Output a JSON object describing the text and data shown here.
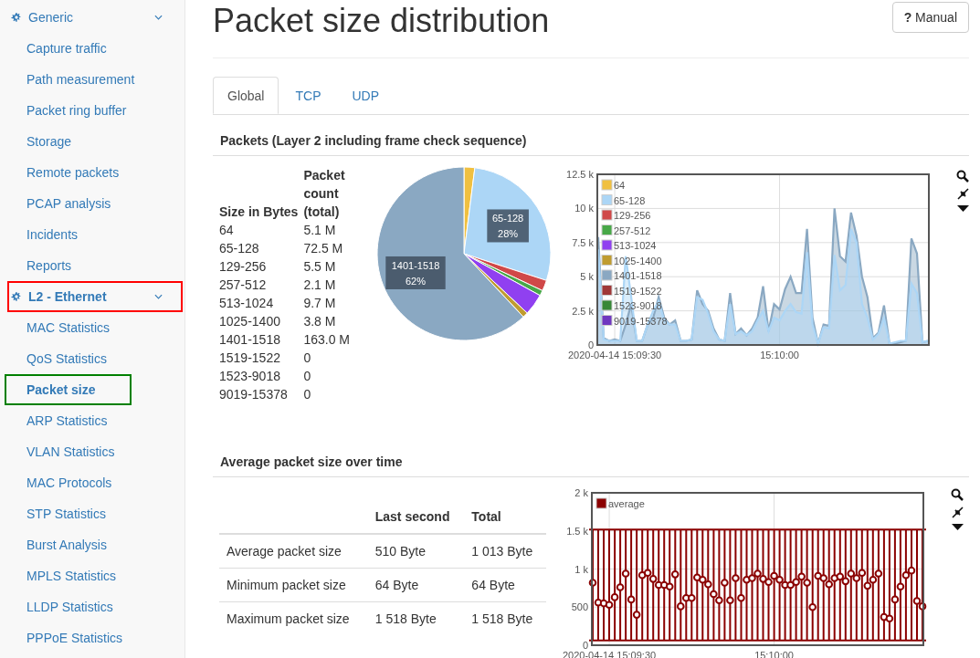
{
  "sidebar": {
    "groups": [
      {
        "label": "Generic",
        "expanded": true,
        "active": false,
        "items": [
          {
            "label": "Capture traffic",
            "selected": false
          },
          {
            "label": "Path measurement",
            "selected": false
          },
          {
            "label": "Packet ring buffer",
            "selected": false
          },
          {
            "label": "Storage",
            "selected": false
          },
          {
            "label": "Remote packets",
            "selected": false
          },
          {
            "label": "PCAP analysis",
            "selected": false
          },
          {
            "label": "Incidents",
            "selected": false
          },
          {
            "label": "Reports",
            "selected": false
          }
        ]
      },
      {
        "label": "L2 - Ethernet",
        "expanded": true,
        "active": true,
        "color": "#ff0000",
        "items": [
          {
            "label": "MAC Statistics",
            "selected": false
          },
          {
            "label": "QoS Statistics",
            "selected": false
          },
          {
            "label": "Packet size",
            "selected": true,
            "color": "#008000"
          },
          {
            "label": "ARP Statistics",
            "selected": false
          },
          {
            "label": "VLAN Statistics",
            "selected": false
          },
          {
            "label": "MAC Protocols",
            "selected": false
          },
          {
            "label": "STP Statistics",
            "selected": false
          },
          {
            "label": "Burst Analysis",
            "selected": false
          },
          {
            "label": "MPLS Statistics",
            "selected": false
          },
          {
            "label": "LLDP Statistics",
            "selected": false
          },
          {
            "label": "PPPoE Statistics",
            "selected": false
          }
        ]
      }
    ]
  },
  "page": {
    "title": "Packet size distribution",
    "manual_button": {
      "icon": "?",
      "label": "Manual"
    }
  },
  "tabs": [
    {
      "label": "Global",
      "selected": true
    },
    {
      "label": "TCP",
      "selected": false
    },
    {
      "label": "UDP",
      "selected": false
    }
  ],
  "packets_section": {
    "title": "Packets (Layer 2 including frame check sequence)",
    "table": {
      "columns": [
        "Size in Bytes",
        "Packet count (total)"
      ],
      "rows": [
        [
          "64",
          "5.1 M"
        ],
        [
          "65-128",
          "72.5 M"
        ],
        [
          "129-256",
          "5.5 M"
        ],
        [
          "257-512",
          "2.1 M"
        ],
        [
          "513-1024",
          "9.7 M"
        ],
        [
          "1025-1400",
          "3.8 M"
        ],
        [
          "1401-1518",
          "163.0 M"
        ],
        [
          "1519-1522",
          "0"
        ],
        [
          "1523-9018",
          "0"
        ],
        [
          "9019-15378",
          "0"
        ]
      ]
    },
    "pie": {
      "chart_data": {
        "type": "pie",
        "categories": [
          null,
          "65-128",
          null,
          null,
          null,
          null,
          "1401-1518"
        ],
        "series": [
          {
            "colors": [
              "#f0c040",
              "#acd6f6",
              "#d04848",
              "#48a848",
              "#9040f0",
              "#c09c30",
              "#8aa8c2"
            ],
            "values": [
              2,
              28,
              2,
              1,
              4,
              1,
              62
            ]
          }
        ],
        "value_labels": [
          null,
          "28%",
          null,
          null,
          null,
          null,
          "62%"
        ]
      }
    },
    "timeline": {
      "chart_data": {
        "type": "area",
        "stacked": false,
        "grid": true,
        "legend": true,
        "ylim": [
          0,
          12500
        ],
        "yticks": [
          {
            "value": 0,
            "label": "0"
          },
          {
            "value": 2500,
            "label": "2.5 k"
          },
          {
            "value": 5000,
            "label": "5 k"
          },
          {
            "value": 7500,
            "label": "7.5 k"
          },
          {
            "value": 10000,
            "label": "10 k"
          },
          {
            "value": 12500,
            "label": "12.5 k"
          }
        ],
        "categories": [
          null,
          null,
          null,
          "2020-04-14 15:09:30",
          null,
          null,
          null,
          null,
          null,
          null,
          null,
          null,
          null,
          null,
          null,
          null,
          null,
          null,
          null,
          null,
          null,
          null,
          null,
          null,
          null,
          null,
          null,
          null,
          null,
          null,
          null,
          null,
          null,
          "15:10:00",
          null,
          null,
          null,
          null,
          null,
          null,
          null,
          null,
          null,
          null,
          null,
          null,
          null,
          null,
          null,
          null,
          null,
          null,
          null,
          null,
          null,
          null,
          null,
          null,
          null,
          null,
          null
        ],
        "series": [
          {
            "name": "64",
            "color": "#f0c040",
            "values": [
              null,
              null,
              null,
              null,
              null,
              null,
              null,
              null,
              null,
              null,
              null,
              null,
              null,
              null,
              null,
              null,
              null,
              null,
              null,
              null,
              null,
              null,
              null,
              null,
              null,
              null,
              null,
              null,
              null,
              null,
              null,
              null,
              null,
              null,
              null,
              null,
              null,
              null,
              null,
              null,
              null,
              null,
              null,
              null,
              null,
              null,
              null,
              null,
              null,
              null,
              null,
              null,
              null,
              null,
              null,
              null,
              null,
              null,
              null,
              null,
              null
            ]
          },
          {
            "name": "65-128",
            "color": "#acd6f6",
            "values": [
              7000,
              400,
              300,
              300,
              300,
              6500,
              3500,
              300,
              300,
              1500,
              2500,
              3200,
              1800,
              1500,
              1500,
              300,
              300,
              400,
              3500,
              3300,
              2300,
              1000,
              400,
              300,
              3000,
              800,
              1000,
              700,
              1000,
              1800,
              2500,
              1000,
              2000,
              1800,
              2500,
              3000,
              2400,
              2300,
              6800,
              1500,
              100,
              1300,
              1200,
              6600,
              4000,
              4400,
              8500,
              7500,
              3000,
              2000,
              400,
              800,
              2000,
              100,
              200,
              300,
              300,
              4500,
              3800,
              200,
              300
            ]
          },
          {
            "name": "129-256",
            "color": "#d04848",
            "values": [
              null,
              null,
              null,
              null,
              null,
              null,
              null,
              null,
              null,
              null,
              null,
              null,
              null,
              null,
              null,
              null,
              null,
              null,
              null,
              null,
              null,
              null,
              null,
              null,
              null,
              null,
              null,
              null,
              null,
              null,
              null,
              null,
              null,
              null,
              null,
              null,
              null,
              null,
              null,
              null,
              null,
              null,
              null,
              null,
              null,
              null,
              null,
              null,
              null,
              null,
              null,
              null,
              null,
              null,
              null,
              null,
              null,
              null,
              null,
              null,
              null
            ]
          },
          {
            "name": "257-512",
            "color": "#48a848",
            "values": [
              null,
              null,
              null,
              null,
              null,
              null,
              null,
              null,
              null,
              null,
              null,
              null,
              null,
              null,
              null,
              null,
              null,
              null,
              null,
              null,
              null,
              null,
              null,
              null,
              null,
              null,
              null,
              null,
              null,
              null,
              null,
              null,
              null,
              null,
              null,
              null,
              null,
              null,
              null,
              null,
              null,
              null,
              null,
              null,
              null,
              null,
              null,
              null,
              null,
              null,
              null,
              null,
              null,
              null,
              null,
              null,
              null,
              null,
              null,
              null,
              null
            ]
          },
          {
            "name": "513-1024",
            "color": "#9040f0",
            "values": [
              null,
              null,
              null,
              null,
              null,
              null,
              null,
              null,
              null,
              null,
              null,
              null,
              null,
              null,
              null,
              null,
              null,
              null,
              null,
              null,
              null,
              null,
              null,
              null,
              null,
              null,
              null,
              null,
              null,
              null,
              null,
              null,
              null,
              null,
              null,
              null,
              null,
              null,
              null,
              null,
              null,
              null,
              null,
              null,
              null,
              null,
              null,
              null,
              null,
              null,
              null,
              null,
              null,
              null,
              null,
              null,
              null,
              null,
              null,
              null,
              null
            ]
          },
          {
            "name": "1025-1400",
            "color": "#c09c30",
            "values": [
              null,
              null,
              null,
              null,
              null,
              null,
              null,
              null,
              null,
              null,
              null,
              null,
              null,
              null,
              null,
              null,
              null,
              null,
              null,
              null,
              null,
              null,
              null,
              null,
              null,
              null,
              null,
              null,
              null,
              null,
              null,
              null,
              null,
              null,
              null,
              null,
              null,
              null,
              null,
              null,
              null,
              null,
              null,
              null,
              null,
              null,
              null,
              null,
              null,
              null,
              null,
              null,
              null,
              null,
              null,
              null,
              null,
              null,
              null,
              null,
              null
            ]
          },
          {
            "name": "1401-1518",
            "color": "#8aa8c2",
            "values": [
              7900,
              500,
              300,
              400,
              300,
              1500,
              3000,
              300,
              300,
              1500,
              2000,
              3500,
              2000,
              1500,
              1800,
              300,
              300,
              400,
              4000,
              3000,
              2500,
              1200,
              400,
              300,
              3800,
              800,
              1200,
              700,
              1200,
              2000,
              4300,
              1000,
              3000,
              2600,
              4100,
              5000,
              3800,
              3800,
              8500,
              2000,
              100,
              1500,
              1400,
              10000,
              6500,
              6100,
              9700,
              8000,
              5000,
              3500,
              500,
              900,
              2900,
              100,
              100,
              200,
              300,
              7800,
              6700,
              200,
              300
            ]
          },
          {
            "name": "1519-1522",
            "color": "#a03838",
            "values": [
              null,
              null,
              null,
              null,
              null,
              null,
              null,
              null,
              null,
              null,
              null,
              null,
              null,
              null,
              null,
              null,
              null,
              null,
              null,
              null,
              null,
              null,
              null,
              null,
              null,
              null,
              null,
              null,
              null,
              null,
              null,
              null,
              null,
              null,
              null,
              null,
              null,
              null,
              null,
              null,
              null,
              null,
              null,
              null,
              null,
              null,
              null,
              null,
              null,
              null,
              null,
              null,
              null,
              null,
              null,
              null,
              null,
              null,
              null,
              null,
              null
            ]
          },
          {
            "name": "1523-9018",
            "color": "#388838",
            "values": [
              null,
              null,
              null,
              null,
              null,
              null,
              null,
              null,
              null,
              null,
              null,
              null,
              null,
              null,
              null,
              null,
              null,
              null,
              null,
              null,
              null,
              null,
              null,
              null,
              null,
              null,
              null,
              null,
              null,
              null,
              null,
              null,
              null,
              null,
              null,
              null,
              null,
              null,
              null,
              null,
              null,
              null,
              null,
              null,
              null,
              null,
              null,
              null,
              null,
              null,
              null,
              null,
              null,
              null,
              null,
              null,
              null,
              null,
              null,
              null,
              null
            ]
          },
          {
            "name": "9019-15378",
            "color": "#7038c0",
            "values": [
              null,
              null,
              null,
              null,
              null,
              null,
              null,
              null,
              null,
              null,
              null,
              null,
              null,
              null,
              null,
              null,
              null,
              null,
              null,
              null,
              null,
              null,
              null,
              null,
              null,
              null,
              null,
              null,
              null,
              null,
              null,
              null,
              null,
              null,
              null,
              null,
              null,
              null,
              null,
              null,
              null,
              null,
              null,
              null,
              null,
              null,
              null,
              null,
              null,
              null,
              null,
              null,
              null,
              null,
              null,
              null,
              null,
              null,
              null,
              null,
              null
            ]
          }
        ]
      }
    }
  },
  "average_section": {
    "title": "Average packet size over time",
    "table": {
      "columns": [
        "",
        "Last second",
        "Total"
      ],
      "rows": [
        [
          "Average packet size",
          "510 Byte",
          "1 013 Byte"
        ],
        [
          "Minimum packet size",
          "64 Byte",
          "64 Byte"
        ],
        [
          "Maximum packet size",
          "1 518 Byte",
          "1 518 Byte"
        ]
      ]
    },
    "timeline": {
      "chart_data": {
        "type": "scatter",
        "grid": true,
        "legend": true,
        "ylim": [
          0,
          2000
        ],
        "yticks": [
          {
            "value": 0,
            "label": "0"
          },
          {
            "value": 500,
            "label": "500"
          },
          {
            "value": 1000,
            "label": "1 k"
          },
          {
            "value": 1500,
            "label": "1.5 k"
          },
          {
            "value": 2000,
            "label": "2 k"
          }
        ],
        "categories": [
          null,
          null,
          null,
          "2020-04-14 15:09:30",
          null,
          null,
          null,
          null,
          null,
          null,
          null,
          null,
          null,
          null,
          null,
          null,
          null,
          null,
          null,
          null,
          null,
          null,
          null,
          null,
          null,
          null,
          null,
          null,
          null,
          null,
          null,
          null,
          null,
          "15:10:00",
          null,
          null,
          null,
          null,
          null,
          null,
          null,
          null,
          null,
          null,
          null,
          null,
          null,
          null,
          null,
          null,
          null,
          null,
          null,
          null,
          null,
          null,
          null,
          null,
          null,
          null,
          null
        ],
        "series": [
          {
            "name": "average",
            "color": "#8b0000",
            "values": [
              820,
              560,
              550,
              530,
              630,
              760,
              940,
              600,
              400,
              920,
              950,
              870,
              790,
              790,
              770,
              930,
              510,
              620,
              620,
              890,
              860,
              800,
              670,
              590,
              820,
              590,
              880,
              620,
              860,
              880,
              940,
              870,
              830,
              910,
              860,
              790,
              790,
              830,
              900,
              820,
              500,
              910,
              880,
              800,
              880,
              900,
              840,
              940,
              880,
              950,
              780,
              860,
              940,
              370,
              350,
              600,
              770,
              920,
              980,
              580,
              510
            ]
          }
        ]
      }
    }
  }
}
